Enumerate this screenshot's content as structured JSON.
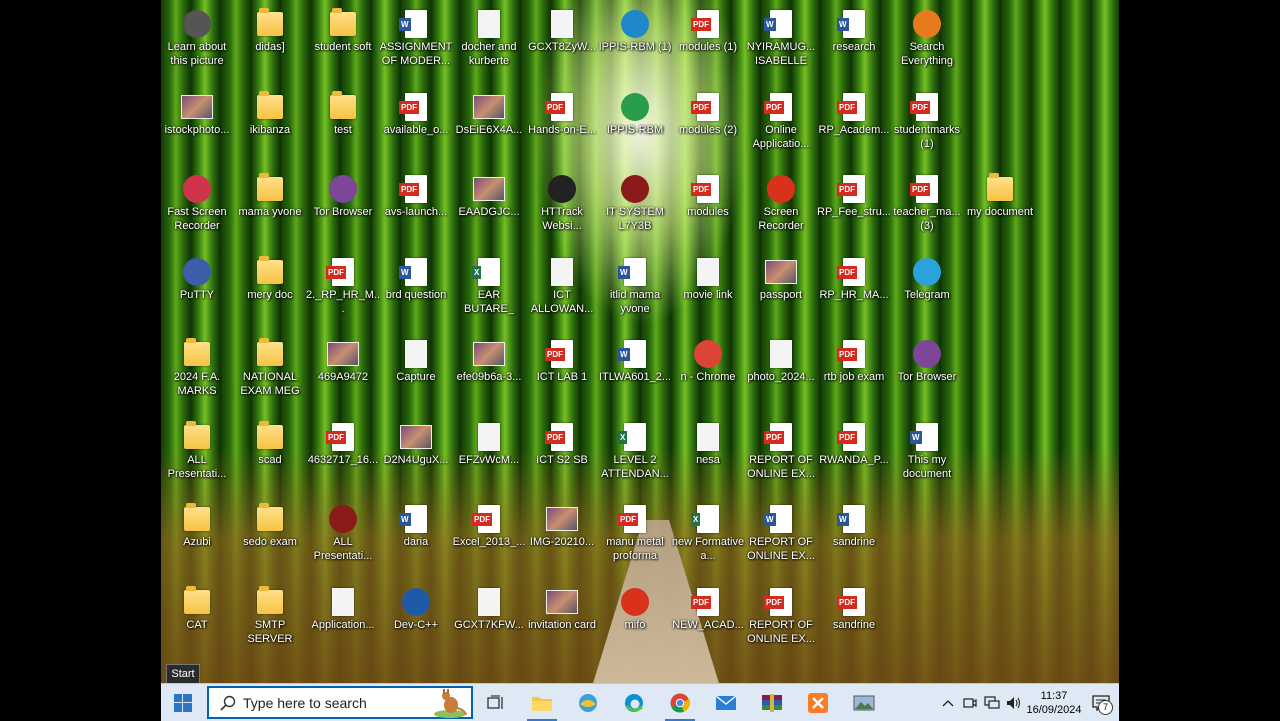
{
  "desktop": {
    "icons": [
      {
        "label": "Learn about this picture",
        "type": "app",
        "color": "#555555"
      },
      {
        "label": "didas]",
        "type": "folder"
      },
      {
        "label": "student soft",
        "type": "folder"
      },
      {
        "label": "ASSIGNMENT OF MODER...",
        "type": "word"
      },
      {
        "label": "docher and kurberte",
        "type": "generic"
      },
      {
        "label": "GCXT8ZyW...",
        "type": "generic"
      },
      {
        "label": "IPPIS-RBM (1)",
        "type": "app",
        "color": "#1e88c8"
      },
      {
        "label": "modules (1)",
        "type": "pdf"
      },
      {
        "label": "NYIRAMUG... ISABELLE",
        "type": "word"
      },
      {
        "label": "research",
        "type": "word"
      },
      {
        "label": "Search Everything",
        "type": "app",
        "color": "#e87a1e"
      },
      {
        "label": "istockphoto...",
        "type": "image"
      },
      {
        "label": "ikibanza",
        "type": "folder"
      },
      {
        "label": "test",
        "type": "folder"
      },
      {
        "label": "available_o...",
        "type": "pdf"
      },
      {
        "label": "DsEiE6X4A...",
        "type": "image"
      },
      {
        "label": "Hands-on-E...",
        "type": "pdf"
      },
      {
        "label": "IPPIS-RBM",
        "type": "app",
        "color": "#2a9d4a"
      },
      {
        "label": "modules (2)",
        "type": "pdf"
      },
      {
        "label": "Online Applicatio...",
        "type": "pdf"
      },
      {
        "label": "RP_Academ...",
        "type": "pdf"
      },
      {
        "label": "studentmarks (1)",
        "type": "pdf"
      },
      {
        "label": "Fast Screen Recorder",
        "type": "app",
        "color": "#d0344a"
      },
      {
        "label": "mama yvone",
        "type": "folder"
      },
      {
        "label": "Tor Browser",
        "type": "app",
        "color": "#7d4698"
      },
      {
        "label": "avs-launch...",
        "type": "pdf"
      },
      {
        "label": "EAADGJC...",
        "type": "image"
      },
      {
        "label": "HTTrack Websi...",
        "type": "app",
        "color": "#222222"
      },
      {
        "label": "IT SYSTEM L7Y3B",
        "type": "app",
        "color": "#8b1a1a"
      },
      {
        "label": "modules",
        "type": "pdf"
      },
      {
        "label": "Screen Recorder",
        "type": "app",
        "color": "#d8321a"
      },
      {
        "label": "RP_Fee_stru...",
        "type": "pdf"
      },
      {
        "label": "teacher_ma... (3)",
        "type": "pdf"
      },
      {
        "label": "my document",
        "type": "folder"
      },
      {
        "label": "PuTTY",
        "type": "app",
        "color": "#3a5fa8"
      },
      {
        "label": "mery doc",
        "type": "folder"
      },
      {
        "label": "2._RP_HR_M...",
        "type": "pdf"
      },
      {
        "label": "brd question",
        "type": "word"
      },
      {
        "label": "EAR BUTARE_ amakuru y'i...",
        "type": "excel"
      },
      {
        "label": "ICT ALLOWAN...",
        "type": "generic"
      },
      {
        "label": "itlid mama yvone",
        "type": "word"
      },
      {
        "label": "movie link",
        "type": "generic"
      },
      {
        "label": "passport",
        "type": "image"
      },
      {
        "label": "RP_HR_MA...",
        "type": "pdf"
      },
      {
        "label": "Telegram",
        "type": "app",
        "color": "#2aa3dc"
      },
      {
        "label": "2024 F.A. MARKS",
        "type": "folder"
      },
      {
        "label": "NATIONAL EXAM MEG",
        "type": "folder"
      },
      {
        "label": "469A9472",
        "type": "image"
      },
      {
        "label": "Capture",
        "type": "generic"
      },
      {
        "label": "efe09b6a-3...",
        "type": "image"
      },
      {
        "label": "ICT LAB 1",
        "type": "pdf"
      },
      {
        "label": "ITLWA601_2...",
        "type": "word"
      },
      {
        "label": "n - Chrome",
        "type": "app",
        "color": "#db4437"
      },
      {
        "label": "photo_2024...",
        "type": "generic"
      },
      {
        "label": "rtb job exam",
        "type": "pdf"
      },
      {
        "label": "Tor Browser",
        "type": "app",
        "color": "#7d4698"
      },
      {
        "label": "ALL Presentati...",
        "type": "folder"
      },
      {
        "label": "scad",
        "type": "folder"
      },
      {
        "label": "4632717_16...",
        "type": "pdf"
      },
      {
        "label": "D2N4UguX...",
        "type": "image"
      },
      {
        "label": "EFZvWcM...",
        "type": "generic"
      },
      {
        "label": "ICT S2 SB",
        "type": "pdf"
      },
      {
        "label": "LEVEL 2 ATTENDAN...",
        "type": "excel"
      },
      {
        "label": "nesa",
        "type": "generic"
      },
      {
        "label": "REPORT OF ONLINE EX...",
        "type": "pdf"
      },
      {
        "label": "RWANDA_P...",
        "type": "pdf"
      },
      {
        "label": "This my document",
        "type": "word"
      },
      {
        "label": "Azubi",
        "type": "folder"
      },
      {
        "label": "sedo exam",
        "type": "folder"
      },
      {
        "label": "ALL Presentati...",
        "type": "app",
        "color": "#8b1a1a"
      },
      {
        "label": "daria",
        "type": "word"
      },
      {
        "label": "Excel_2013_...",
        "type": "pdf"
      },
      {
        "label": "IMG-20210...",
        "type": "image"
      },
      {
        "label": "manu metal proforma",
        "type": "pdf"
      },
      {
        "label": "new Formative a...",
        "type": "excel"
      },
      {
        "label": "REPORT OF ONLINE EX...",
        "type": "word"
      },
      {
        "label": "sandrine",
        "type": "word"
      },
      {
        "label": "CAT",
        "type": "folder"
      },
      {
        "label": "SMTP SERVER",
        "type": "folder"
      },
      {
        "label": "Application...",
        "type": "generic"
      },
      {
        "label": "Dev-C++",
        "type": "app",
        "color": "#1e5aa8"
      },
      {
        "label": "GCXT7KFW...",
        "type": "generic"
      },
      {
        "label": "invitation card",
        "type": "image"
      },
      {
        "label": "mifo",
        "type": "app",
        "color": "#d8321a"
      },
      {
        "label": "NEW_ACAD...",
        "type": "pdf"
      },
      {
        "label": "REPORT OF ONLINE EX...",
        "type": "pdf"
      },
      {
        "label": "sandrine",
        "type": "pdf"
      }
    ]
  },
  "tooltip": {
    "text": "Start"
  },
  "taskbar": {
    "search_placeholder": "Type here to search",
    "clock_time": "11:37",
    "clock_date": "16/09/2024",
    "notification_count": "7"
  },
  "colors": {
    "taskbar": "#dfe9f5",
    "accent": "#0063b1",
    "pdf": "#d52b1e",
    "word": "#2b579a",
    "excel": "#217346"
  }
}
